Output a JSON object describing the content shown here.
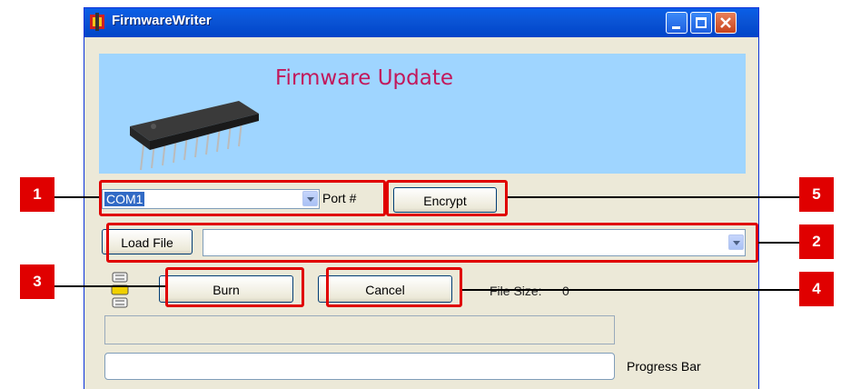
{
  "window": {
    "title": "FirmwareWriter",
    "banner_title": "Firmware Update"
  },
  "port": {
    "selected": "COM1",
    "label": "Port #"
  },
  "buttons": {
    "encrypt": "Encrypt",
    "load_file": "Load File",
    "burn": "Burn",
    "cancel": "Cancel"
  },
  "file": {
    "path": "",
    "size_label": "File Size:",
    "size_value": "0"
  },
  "progress": {
    "label": "Progress Bar",
    "value": 0
  },
  "annotations": [
    "1",
    "2",
    "3",
    "4",
    "5"
  ],
  "colors": {
    "highlight": "#e00000",
    "banner_bg": "#9fd5ff",
    "banner_text": "#c2185b",
    "titlebar": "#0055e5"
  }
}
